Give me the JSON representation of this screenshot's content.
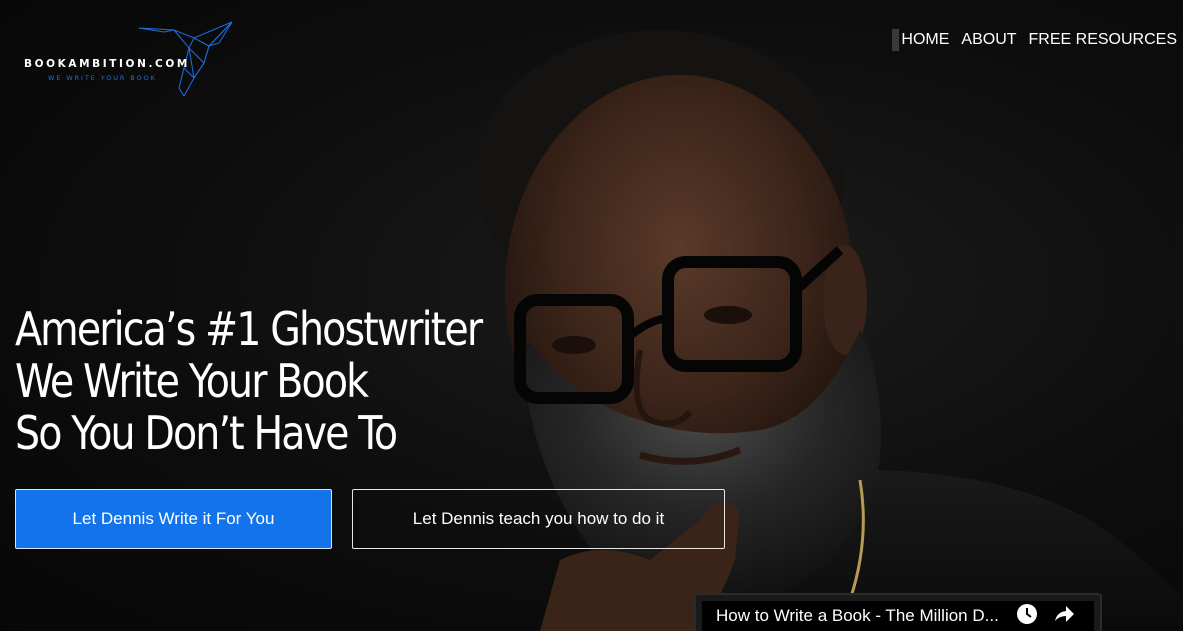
{
  "brand": {
    "name": "BOOKAMBITION.COM",
    "tagline": "WE WRITE YOUR BOOK",
    "accent_color": "#1e6fe0",
    "icon": "hummingbird-logo-icon"
  },
  "nav": {
    "items": [
      {
        "label": "HOME",
        "active": true
      },
      {
        "label": "ABOUT",
        "active": false
      },
      {
        "label": "FREE RESOURCES",
        "active": false
      }
    ]
  },
  "hero": {
    "headline_lines": [
      "America’s #1 Ghostwriter",
      "We Write Your Book",
      "So You Don’t Have To"
    ],
    "primary_button": "Let Dennis Write it For You",
    "secondary_button": "Let Dennis teach you how to do it",
    "primary_color": "#1273eb"
  },
  "video": {
    "title": "How to Write a Book - The Million D...",
    "icons": [
      "clock-icon",
      "share-icon"
    ]
  }
}
